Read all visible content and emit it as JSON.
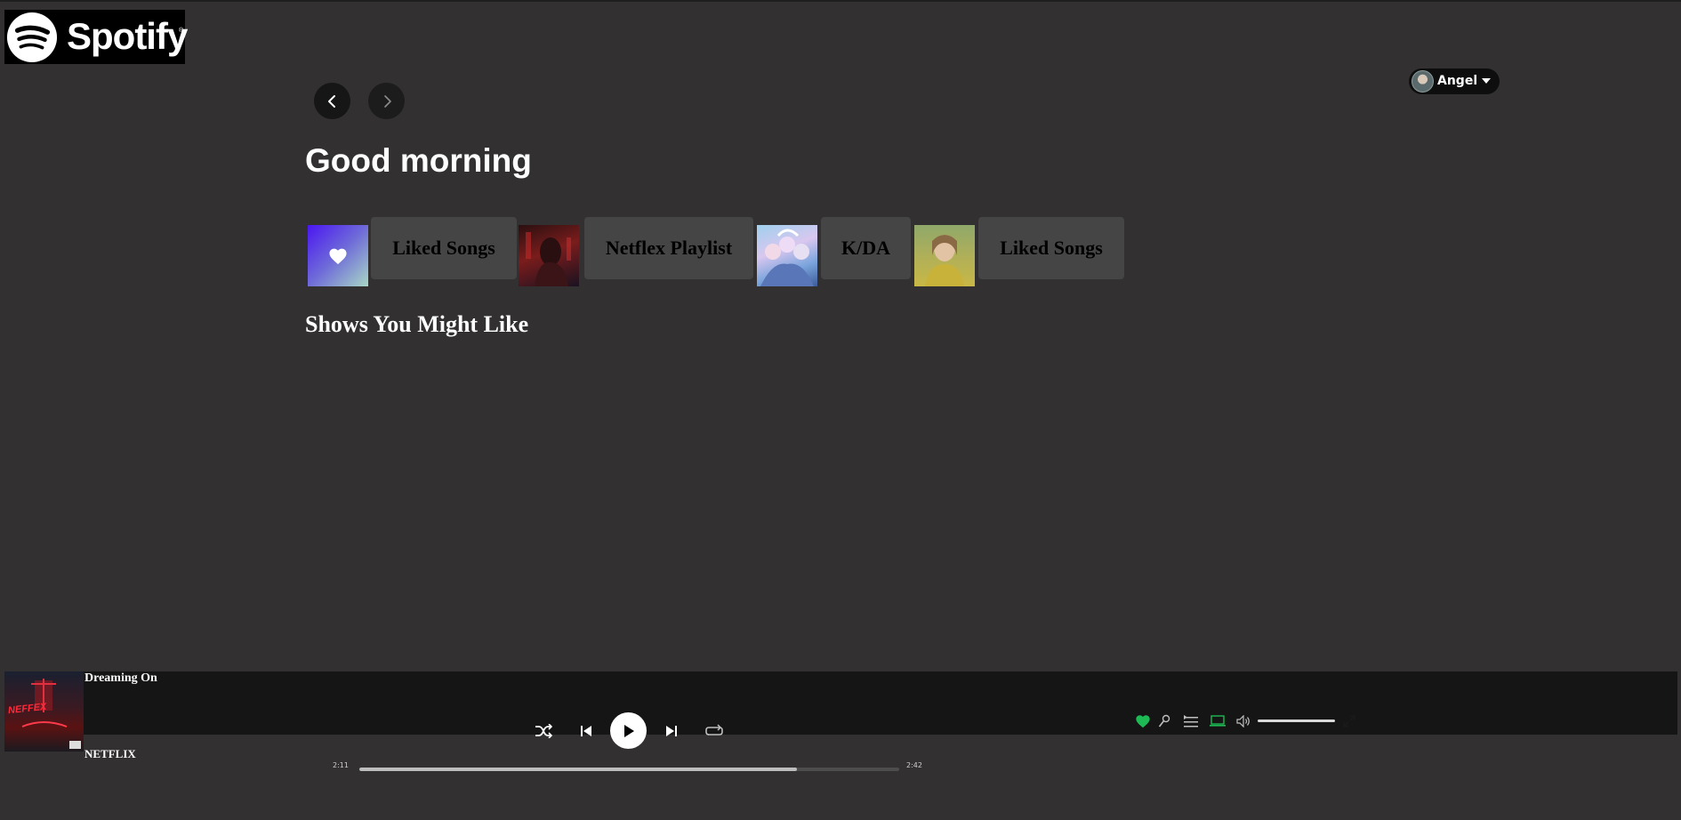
{
  "brand": {
    "name": "Spotify",
    "registered_mark": "®",
    "icon": "spotify-logo-icon"
  },
  "nav": {
    "back_icon": "chevron-left-icon",
    "forward_icon": "chevron-right-icon"
  },
  "user": {
    "name": "Angel",
    "avatar_icon": "user-avatar",
    "menu_icon": "caret-down-icon"
  },
  "home": {
    "greeting": "Good morning",
    "shortcuts": [
      {
        "label": "Liked Songs",
        "cover_icon": "heart-icon"
      },
      {
        "label": "Netflex Playlist"
      },
      {
        "label": "K/DA"
      },
      {
        "label": "Liked Songs"
      }
    ],
    "section_title": "Shows You Might Like"
  },
  "now_playing": {
    "title": "Dreaming On",
    "artist": "NETFLIX",
    "album_art_text": "NEFFEX",
    "elapsed": "2:11",
    "duration": "2:42",
    "progress": 0.81,
    "liked": true,
    "volume": 1.0
  },
  "controls": {
    "shuffle_icon": "shuffle-icon",
    "previous_icon": "skip-previous-icon",
    "play_icon": "play-icon",
    "next_icon": "skip-next-icon",
    "repeat_icon": "repeat-icon",
    "like_icon": "heart-icon",
    "lyrics_icon": "microphone-icon",
    "queue_icon": "queue-icon",
    "device_icon": "connect-device-icon",
    "volume_icon": "volume-icon",
    "fullscreen_icon": "fullscreen-icon"
  },
  "colors": {
    "background": "#323031",
    "player_bar": "#151515",
    "shortcut_label_bg": "#454546",
    "accent_green": "#1db954",
    "liked_cover_start": "#4a16f1",
    "liked_cover_end": "#a8d7c6"
  }
}
